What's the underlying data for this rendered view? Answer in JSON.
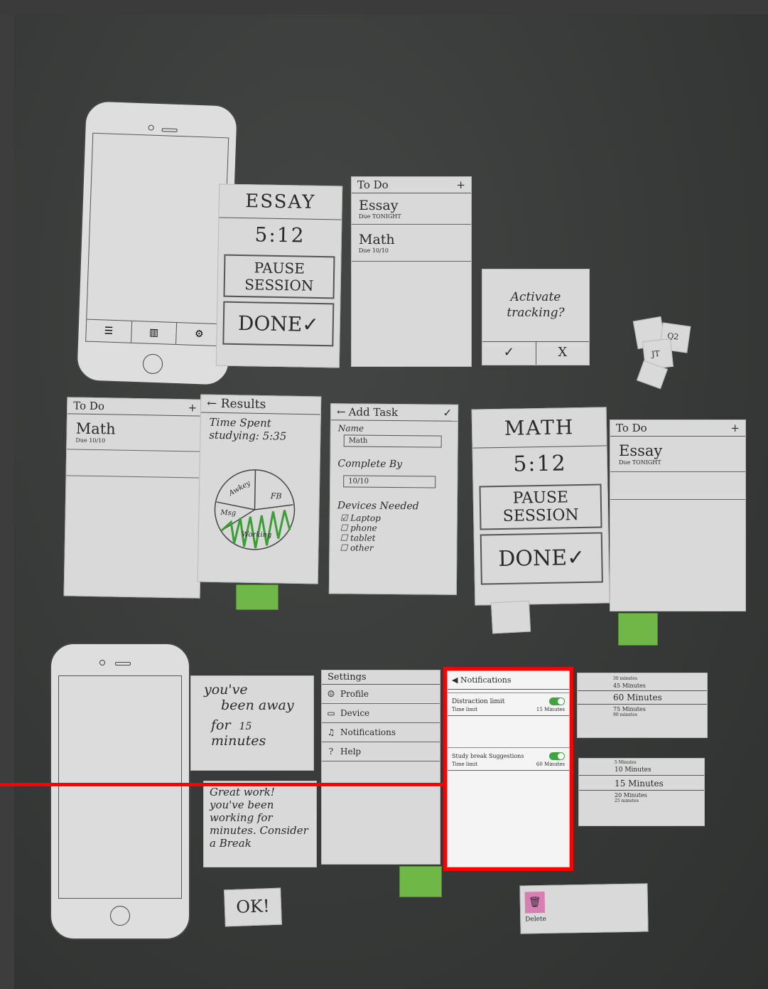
{
  "essay_timer": {
    "title": "ESSAY",
    "time": "5:12",
    "pause": "PAUSE SESSION",
    "done": "DONE✓"
  },
  "todo_1": {
    "header": "To Do",
    "plus": "+",
    "items": [
      {
        "name": "Essay",
        "due": "Due TONIGHT"
      },
      {
        "name": "Math",
        "due": "Due 10/10"
      }
    ]
  },
  "activate": {
    "question": "Activate tracking?",
    "yes": "✓",
    "no": "X"
  },
  "scraps": [
    "JT",
    "Q2"
  ],
  "todo_2": {
    "header": "To Do",
    "plus": "+",
    "item": "Math",
    "due": "Due 10/10"
  },
  "results": {
    "back": "←",
    "title": "Results",
    "line1": "Time Spent",
    "line2": "studying: 5:35",
    "slices": [
      "Awkey",
      "FB",
      "Msg",
      "Working"
    ]
  },
  "add_task": {
    "back": "←",
    "title": "Add Task",
    "check": "✓",
    "name_label": "Name",
    "name_value": "Math",
    "complete_label": "Complete By",
    "complete_value": "10/10",
    "devices_label": "Devices Needed",
    "devices": [
      "☑ Laptop",
      "☐ phone",
      "☐ tablet",
      "☐ other"
    ]
  },
  "math_timer": {
    "title": "MATH",
    "time": "5:12",
    "pause": "PAUSE SESSION",
    "done": "DONE✓"
  },
  "todo_3": {
    "header": "To Do",
    "plus": "+",
    "item": "Essay",
    "due": "Due TONIGHT"
  },
  "away": {
    "line1": "you've",
    "line2": "been away",
    "line3": "for",
    "minutes": "15",
    "line4": "minutes"
  },
  "great": {
    "text": "Great work! you've been working for minutes. Consider a Break"
  },
  "ok": "OK!",
  "settings": {
    "title": "Settings",
    "items": [
      {
        "label": "Profile",
        "icon": "person-icon"
      },
      {
        "label": "Device",
        "icon": "laptop-icon"
      },
      {
        "label": "Notifications",
        "icon": "bell-icon"
      },
      {
        "label": "Help",
        "icon": "help-icon"
      }
    ]
  },
  "notifications": {
    "title": "Notifications",
    "distraction_label": "Distraction limit",
    "distraction_time_label": "Time limit",
    "distraction_time_value": "15 Minutes",
    "break_label": "Study break Suggestions",
    "break_time_label": "Time limit",
    "break_time_value": "60 Minutes"
  },
  "picker_1": [
    "30 minutes",
    "45 Minutes",
    "60 Minutes",
    "75 Minutes",
    "90 minutes"
  ],
  "picker_2": [
    "5 Minutes",
    "10 Minutes",
    "15 Minutes",
    "20 Minutes",
    "25 minutes"
  ],
  "delete": {
    "label": "Delete"
  },
  "colors": {
    "accent": "#ff0000",
    "green": "#6fb848",
    "paper": "#d9d9d9",
    "background": "#383a39"
  }
}
